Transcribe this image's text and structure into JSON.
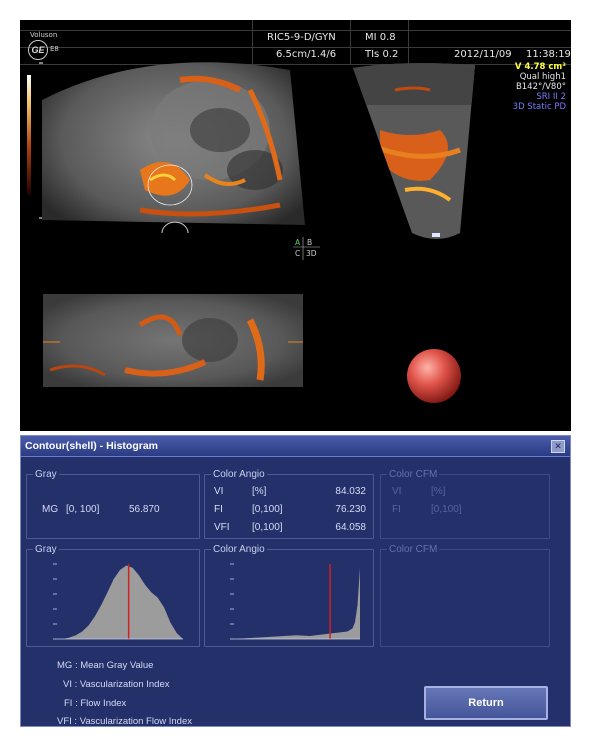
{
  "ultrasound": {
    "brand": "Voluson",
    "model": "E8",
    "logo": "GE",
    "probe": "RIC5-9-D/GYN",
    "mi": "MI 0.8",
    "depth": "6.5cm/1.4/6",
    "tis": "TIs 0.2",
    "date": "2012/11/09",
    "time": "11:38:19",
    "volume": "V 4.78 cm³",
    "quality": "Qual high1",
    "angles": "B142°/V80°",
    "sri": "SRI II 2",
    "mode": "3D Static PD",
    "quadrant_labels": {
      "a": "A",
      "b": "B",
      "c": "C",
      "three_d": "3D"
    },
    "colors": {
      "volume_text": "#ffff40",
      "mode_text": "#7b7bff",
      "flow": "#e8641a"
    }
  },
  "window": {
    "title": "Contour(shell) - Histogram",
    "close_icon": "close-icon",
    "gray_group": {
      "title": "Gray",
      "label": "MG",
      "range": "[0, 100]",
      "value": "56.870"
    },
    "angio_group": {
      "title": "Color Angio",
      "rows": [
        {
          "label": "VI",
          "range": "[%]",
          "value": "84.032"
        },
        {
          "label": "FI",
          "range": "[0,100]",
          "value": "76.230"
        },
        {
          "label": "VFI",
          "range": "[0,100]",
          "value": "64.058"
        }
      ]
    },
    "cfm_group": {
      "title": "Color CFM",
      "rows": [
        {
          "label": "VI",
          "range": "[%]"
        },
        {
          "label": "FI",
          "range": "[0,100]"
        }
      ]
    },
    "hist_gray_title": "Gray",
    "hist_angio_title": "Color Angio",
    "hist_cfm_title": "Color CFM",
    "legend": [
      "MG :  Mean Gray Value",
      "VI :  Vascularization Index",
      "FI :  Flow Index",
      "VFI :  Vascularization Flow Index"
    ],
    "return_label": "Return"
  },
  "chart_data": [
    {
      "type": "area",
      "x": [
        0,
        5,
        10,
        15,
        20,
        25,
        30,
        35,
        40,
        45,
        50,
        55,
        60,
        65,
        70,
        75,
        80,
        85,
        90,
        95,
        100
      ],
      "values": [
        0,
        0,
        2,
        5,
        10,
        18,
        30,
        45,
        62,
        80,
        92,
        98,
        95,
        85,
        72,
        62,
        55,
        42,
        22,
        8,
        0
      ],
      "marker_x": 56.87
    },
    {
      "type": "area",
      "x": [
        0,
        10,
        20,
        30,
        40,
        50,
        60,
        70,
        80,
        90,
        94,
        96,
        98,
        100
      ],
      "values": [
        0,
        1,
        2,
        3,
        4,
        5,
        4,
        6,
        8,
        10,
        14,
        22,
        45,
        95
      ],
      "marker_x": 76.23
    }
  ]
}
